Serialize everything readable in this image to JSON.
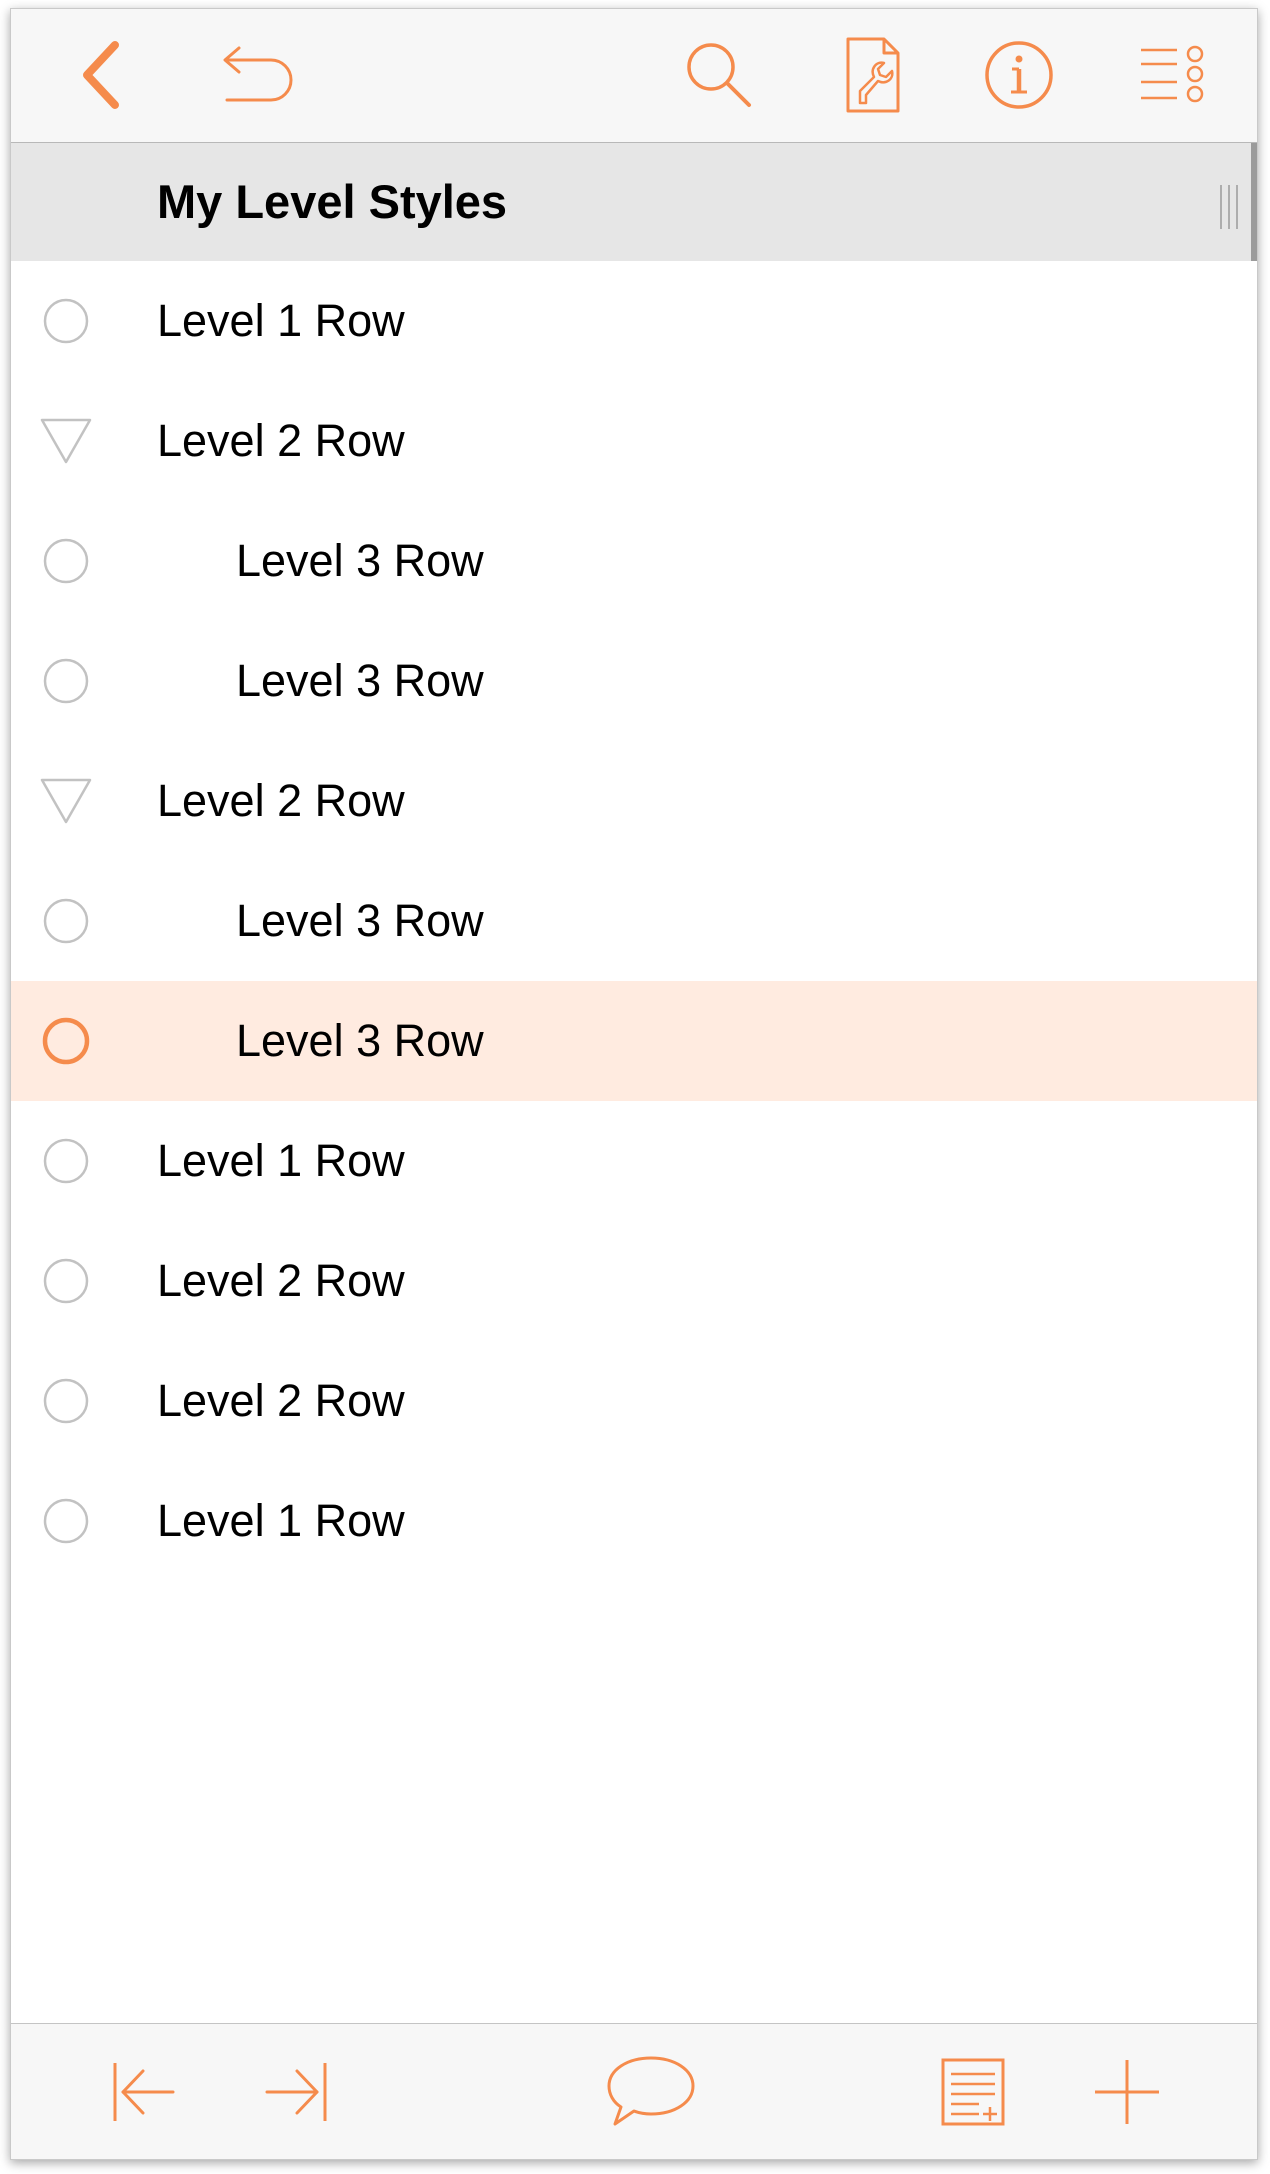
{
  "colors": {
    "accent": "#f58b4c",
    "selected_row": "#ffebe0",
    "toolbar_bg": "#f7f7f7",
    "header_bg": "#e6e6e6",
    "handle_gray": "#c2c2c2"
  },
  "toolbar": {
    "icons": [
      "back-chevron-icon",
      "undo-icon",
      "search-icon",
      "document-wrench-icon",
      "info-icon",
      "outline-menu-icon"
    ]
  },
  "section": {
    "title": "My Level Styles"
  },
  "rows": [
    {
      "label": "Level 1 Row",
      "level": 1,
      "handle": "circle",
      "selected": false
    },
    {
      "label": "Level 2 Row",
      "level": 2,
      "handle": "triangle",
      "selected": false
    },
    {
      "label": "Level 3 Row",
      "level": 3,
      "handle": "circle",
      "selected": false
    },
    {
      "label": "Level 3 Row",
      "level": 3,
      "handle": "circle",
      "selected": false
    },
    {
      "label": "Level 2 Row",
      "level": 2,
      "handle": "triangle",
      "selected": false
    },
    {
      "label": "Level 3 Row",
      "level": 3,
      "handle": "circle",
      "selected": false
    },
    {
      "label": "Level 3 Row",
      "level": 3,
      "handle": "circle",
      "selected": true
    },
    {
      "label": "Level 1 Row",
      "level": 1,
      "handle": "circle",
      "selected": false
    },
    {
      "label": "Level 2 Row",
      "level": 2,
      "handle": "circle",
      "selected": false
    },
    {
      "label": "Level 2 Row",
      "level": 2,
      "handle": "circle",
      "selected": false
    },
    {
      "label": "Level 1 Row",
      "level": 1,
      "handle": "circle",
      "selected": false
    }
  ],
  "bottombar": {
    "icons": [
      "outdent-icon",
      "indent-icon",
      "comment-icon",
      "add-note-icon",
      "add-row-icon"
    ]
  }
}
